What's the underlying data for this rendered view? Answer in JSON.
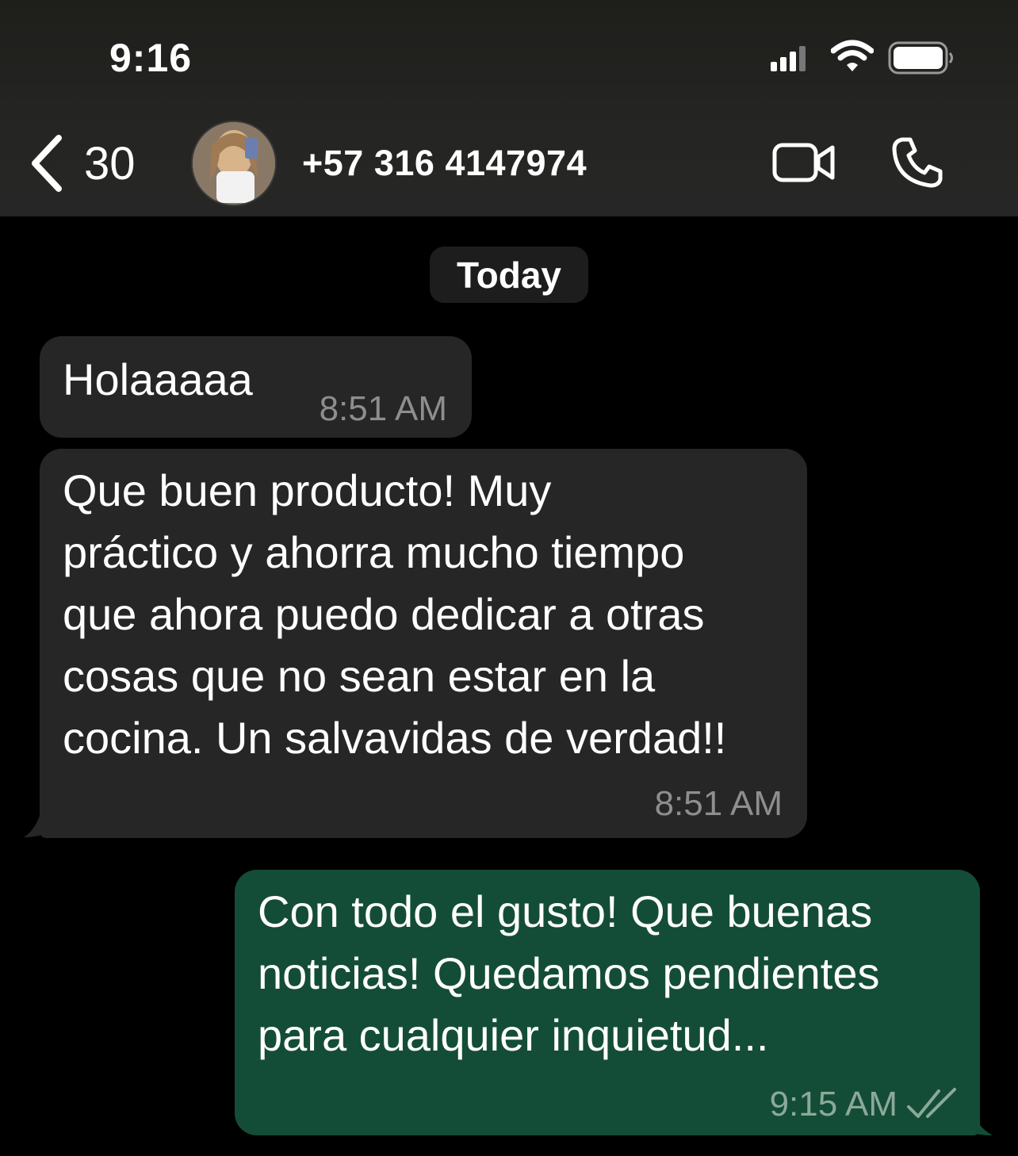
{
  "status_bar": {
    "time": "9:16"
  },
  "header": {
    "back_count": "30",
    "contact_name": "+57 316 4147974"
  },
  "chat": {
    "date_label": "Today",
    "messages": [
      {
        "direction": "incoming",
        "text": "Holaaaaa",
        "time": "8:51 AM"
      },
      {
        "direction": "incoming",
        "text": "Que buen producto! Muy\npráctico y ahorra mucho tiempo\nque ahora puedo dedicar a otras\ncosas que no sean estar en la\ncocina. Un salvavidas de verdad!!",
        "time": "8:51 AM"
      },
      {
        "direction": "outgoing",
        "text": "Con todo el gusto! Que buenas\nnoticias! Quedamos pendientes\npara cualquier inquietud...",
        "time": "9:15 AM",
        "status": "read"
      }
    ]
  },
  "colors": {
    "incoming_bubble": "#262626",
    "outgoing_bubble": "#144d37",
    "background": "#000000"
  }
}
